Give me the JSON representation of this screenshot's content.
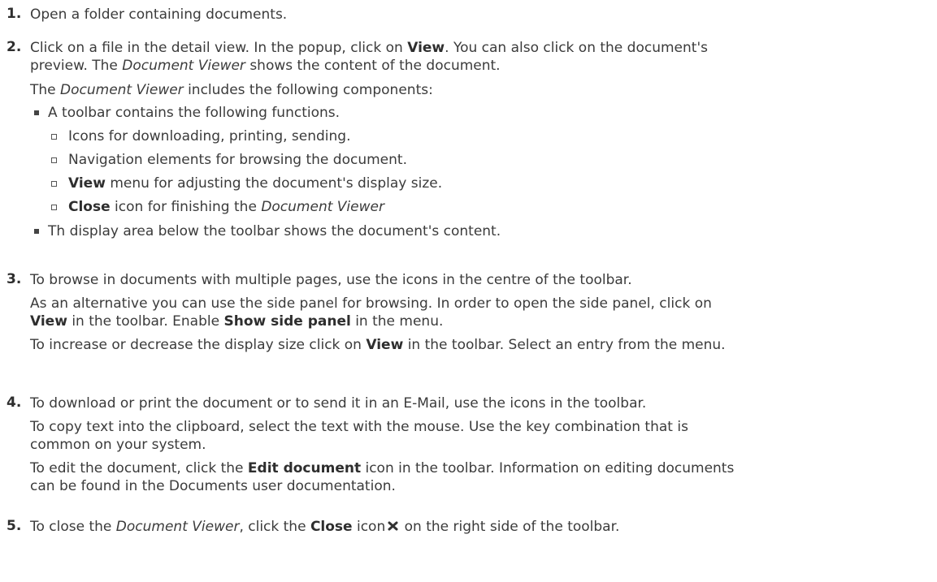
{
  "steps": [
    {
      "num": "1.",
      "text": "Open a folder containing documents."
    },
    {
      "num": "2.",
      "p1_a": "Click on a file in the detail view. In the popup, click on ",
      "p1_b": "View",
      "p1_c": ". You can also click on the document's",
      "p2_a": "preview. The ",
      "p2_b": "Document Viewer",
      "p2_c": " shows the content of the document.",
      "p3_a": "The ",
      "p3_b": "Document Viewer",
      "p3_c": " includes the following components:",
      "bullet1": "A toolbar contains the following functions.",
      "sub": [
        {
          "text": "Icons for downloading, printing, sending."
        },
        {
          "text": "Navigation elements for browsing the document."
        },
        {
          "bold": "View",
          "text": " menu for adjusting the document's display size."
        },
        {
          "bold": "Close",
          "text": " icon for finishing the ",
          "italic": "Document Viewer"
        }
      ],
      "bullet2": "Th display area below the toolbar shows the document's content."
    },
    {
      "num": "3.",
      "l1": "To browse in documents with multiple pages, use the icons in the centre of the toolbar.",
      "l2": "As an alternative you can use the side panel for browsing. In order to open the side panel, click on",
      "l3_b1": "View",
      "l3_a": " in the toolbar. Enable ",
      "l3_b2": "Show side panel",
      "l3_c": " in the menu.",
      "l4_a": "To increase or decrease the display size click on ",
      "l4_b": "View",
      "l4_c": " in the toolbar. Select an entry from the menu."
    },
    {
      "num": "4.",
      "l1": "To download or print the document or to send it in an E-Mail, use the icons in the toolbar.",
      "l2": "To copy text into the clipboard, select the text with the mouse. Use the key combination that is",
      "l3": "common on your system.",
      "l4_a": "To edit the document, click the ",
      "l4_b": "Edit document",
      "l4_c": " icon in the toolbar. Information on editing documents",
      "l5": "can be found in the Documents user documentation."
    },
    {
      "num": "5.",
      "a": "To close the ",
      "b": "Document Viewer",
      "c": ", click the ",
      "d": "Close",
      "e": " icon",
      "f": " on the right side of the toolbar."
    }
  ],
  "icons": {
    "close": "close-icon"
  }
}
